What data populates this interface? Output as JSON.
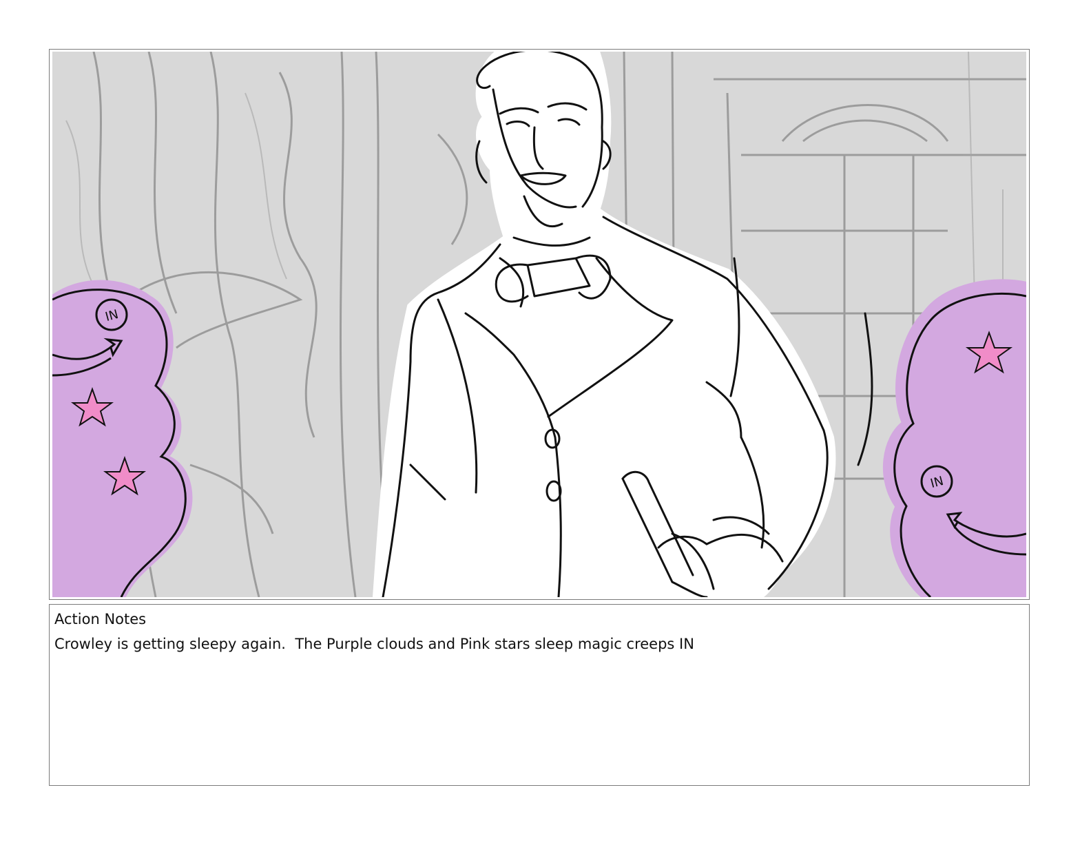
{
  "panel": {
    "image_alt": "Storyboard panel: Crowley in suit and bow tie holding a cane, purple sleep clouds with pink stars creeping in from both sides",
    "cloud_left_label": "IN",
    "cloud_right_label": "IN",
    "colors": {
      "cloud": "#d3a8e0",
      "star": "#f08cc8",
      "background_sketch": "#d6d6d6",
      "line": "#111111"
    }
  },
  "action_notes": {
    "title": "Action Notes",
    "text": "Crowley is getting sleepy again.  The Purple clouds and Pink stars sleep magic creeps IN"
  }
}
